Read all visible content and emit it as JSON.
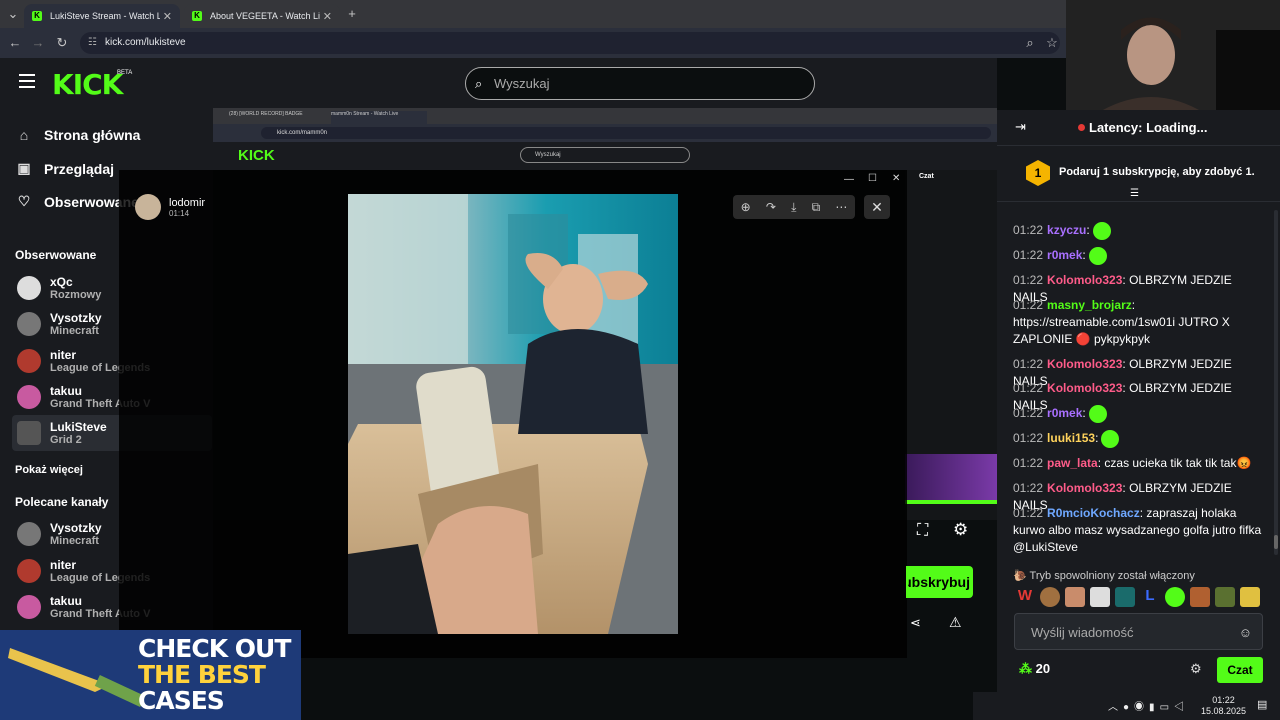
{
  "browser": {
    "tabs": [
      {
        "title": "LukiSteve Stream - Watch Live on Kick",
        "active": true
      },
      {
        "title": "About VEGEETA - Watch Live on Kick",
        "active": false
      }
    ],
    "new_tab": "+",
    "url": "kick.com/lukisteve"
  },
  "kick": {
    "logo": "KICK",
    "beta": "BETA",
    "search_placeholder": "Wyszukaj"
  },
  "sidebar": {
    "nav": [
      {
        "label": "Strona główna",
        "icon": "home-icon"
      },
      {
        "label": "Przeglądaj",
        "icon": "browse-icon"
      },
      {
        "label": "Obserwowane",
        "icon": "heart-icon"
      }
    ],
    "following_title": "Obserwowane",
    "following": [
      {
        "name": "xQc",
        "game": "Rozmowy"
      },
      {
        "name": "Vysotzky",
        "game": "Minecraft"
      },
      {
        "name": "niter",
        "game": "League of Legends"
      },
      {
        "name": "takuu",
        "game": "Grand Theft Auto V"
      },
      {
        "name": "LukiSteve",
        "game": "Grid 2"
      }
    ],
    "show_more": "Pokaż więcej",
    "recommended_title": "Polecane kanały",
    "recommended": [
      {
        "name": "Vysotzky",
        "game": "Minecraft"
      },
      {
        "name": "niter",
        "game": "League of Legends"
      },
      {
        "name": "takuu",
        "game": "Grand Theft Auto V"
      }
    ]
  },
  "inner_screen": {
    "tabs": [
      "(28) [WORLD RECORD] BADGE",
      "mamm0n Stream - Watch Live"
    ],
    "url": "kick.com/mamm0n",
    "search": "Wyszukaj",
    "chat_title": "Czat"
  },
  "image_viewer": {
    "user": "lodomir",
    "time": "01:14",
    "tools": [
      "zoom-in-icon",
      "share-icon",
      "download-icon",
      "open-external-icon",
      "more-icon"
    ],
    "close": "✕"
  },
  "stream": {
    "subscribe_label": "Subskrybuj"
  },
  "banner": {
    "line1": "CHECK OUT",
    "line2": "THE BEST",
    "line3": "CASES"
  },
  "chat": {
    "latency": "Latency: Loading...",
    "gift_badge": "1",
    "gift_text": "Podaruj 1 subskrypcję, aby zdobyć 1.",
    "messages": [
      {
        "time": "01:22",
        "user": "kzyczu",
        "color": "#a970ff",
        "text": "",
        "emote": true
      },
      {
        "time": "01:22",
        "user": "r0mek",
        "color": "#a970ff",
        "text": "",
        "emote": true
      },
      {
        "time": "01:22",
        "user": "Kolomolo323",
        "color": "#ff5c8a",
        "text": "OLBRZYM JEDZIE NAILS",
        "emote": false
      },
      {
        "time": "01:22",
        "user": "masny_brojarz",
        "color": "#53fc18",
        "text": "https://streamable.com/1sw01i JUTRO X ZAPLONIE 🔴 pykpykpyk",
        "emote": false
      },
      {
        "time": "01:22",
        "user": "Kolomolo323",
        "color": "#ff5c8a",
        "text": "OLBRZYM JEDZIE NAILS",
        "emote": false
      },
      {
        "time": "01:22",
        "user": "Kolomolo323",
        "color": "#ff5c8a",
        "text": "OLBRZYM JEDZIE NAILS",
        "emote": false
      },
      {
        "time": "01:22",
        "user": "r0mek",
        "color": "#a970ff",
        "text": "",
        "emote": true
      },
      {
        "time": "01:22",
        "user": "luuki153",
        "color": "#ffd35c",
        "text": "",
        "emote": true
      },
      {
        "time": "01:22",
        "user": "paw_lata",
        "color": "#ff5c8a",
        "text": "czas ucieka tik tak tik tak😡",
        "emote": false
      },
      {
        "time": "01:22",
        "user": "Kolomolo323",
        "color": "#ff5c8a",
        "text": "OLBRZYM JEDZIE NAILS",
        "emote": false
      },
      {
        "time": "01:22",
        "user": "R0mcioKochacz",
        "color": "#6fa8ff",
        "text": "zapraszaj holaka kurwo albo masz wysadzanego golfa jutro fifka @LukiSteve",
        "emote": false
      }
    ],
    "slow_mode": "🐌 Tryb spowolniony został włączony",
    "input_placeholder": "Wyślij wiadomość",
    "points": "20",
    "send_label": "Czat"
  },
  "taskbar": {
    "time": "01:22",
    "date": "15.08.2025"
  },
  "colors": {
    "kick_green": "#53fc18",
    "bg_dark": "#0b0e0f",
    "panel": "#191b1f"
  }
}
